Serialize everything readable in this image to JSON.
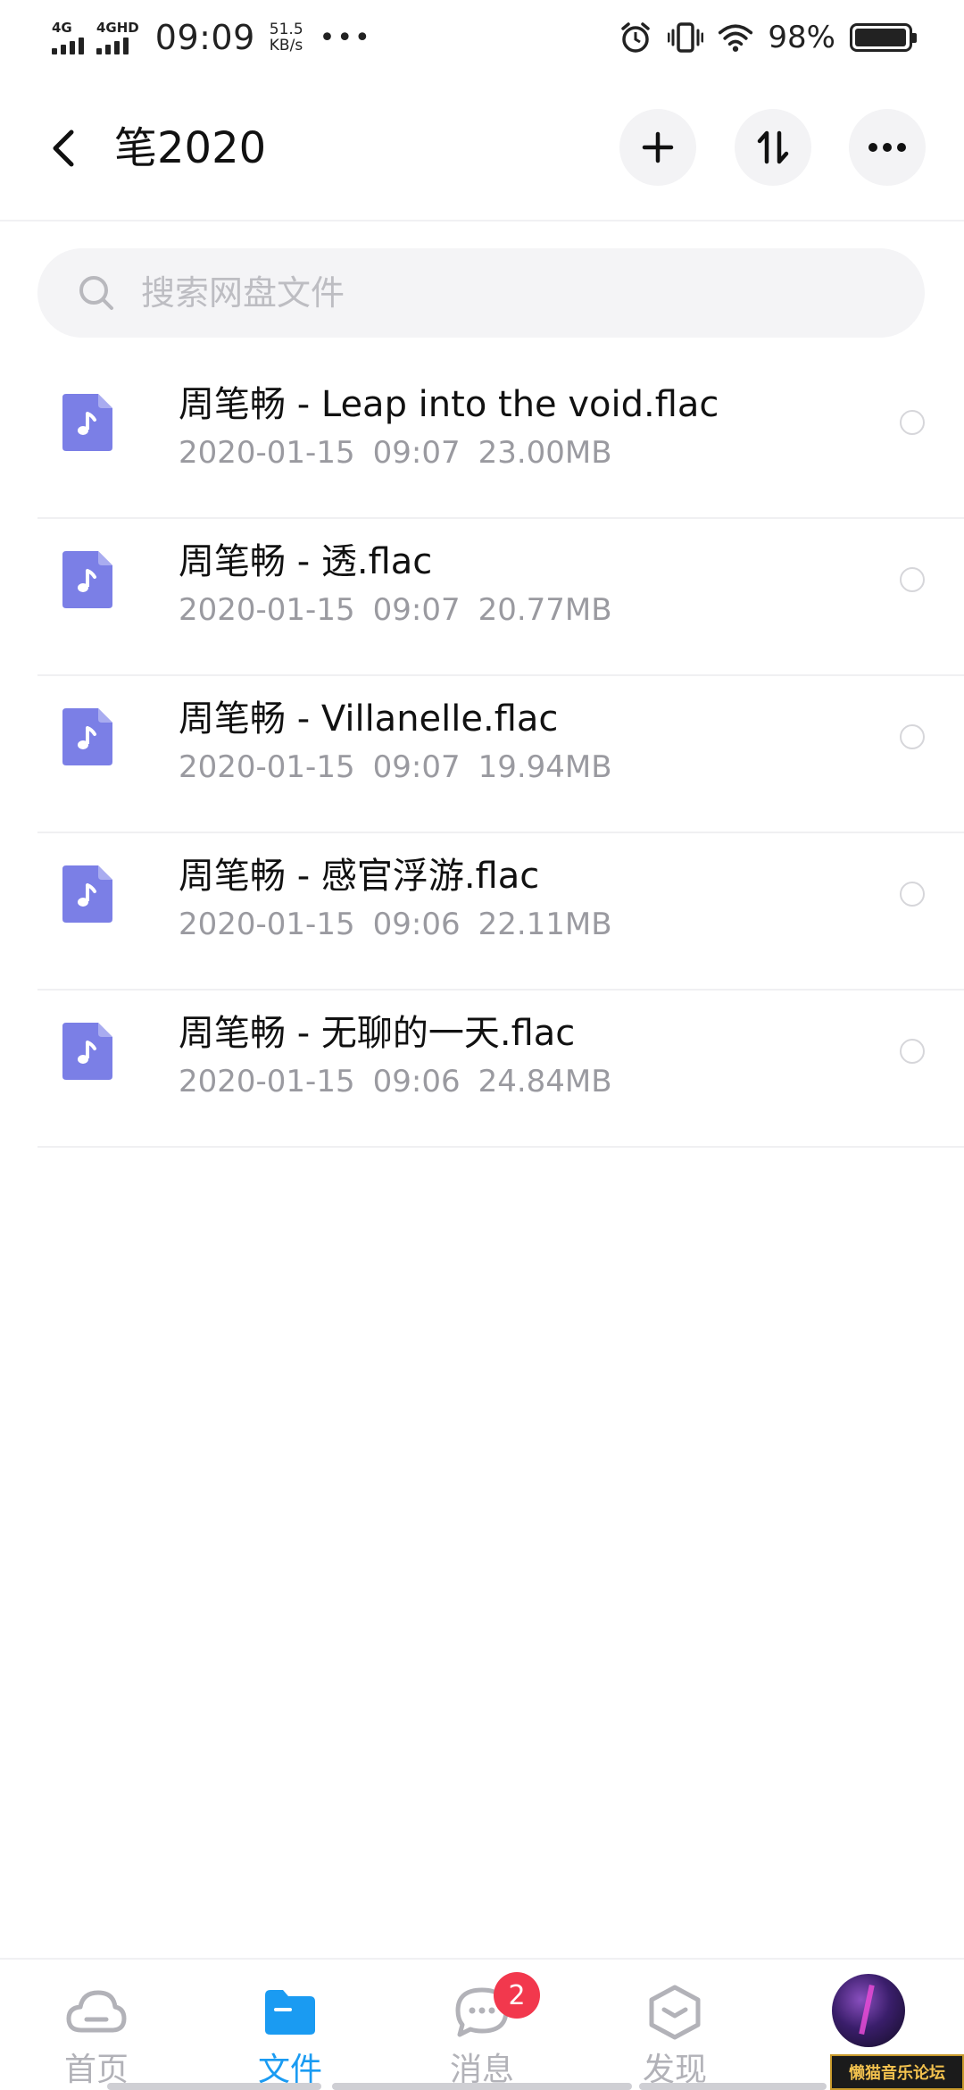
{
  "status_bar": {
    "signal1_label": "4G",
    "signal2_label": "4GHD",
    "time": "09:09",
    "speed_value": "51.5",
    "speed_unit": "KB/s",
    "more": "•••",
    "battery_text": "98%",
    "battery_level": 0.98
  },
  "header": {
    "title": "笔2020",
    "add_icon": "plus-icon",
    "sort_icon": "sort-arrows-icon",
    "more_icon": "more-dots-icon"
  },
  "search": {
    "placeholder": "搜索网盘文件"
  },
  "files": [
    {
      "name": "周笔畅 - Leap into the void.flac",
      "date": "2020-01-15",
      "time": "09:07",
      "size": "23.00MB"
    },
    {
      "name": "周笔畅 - 透.flac",
      "date": "2020-01-15",
      "time": "09:07",
      "size": "20.77MB"
    },
    {
      "name": "周笔畅 - Villanelle.flac",
      "date": "2020-01-15",
      "time": "09:07",
      "size": "19.94MB"
    },
    {
      "name": "周笔畅 - 感官浮游.flac",
      "date": "2020-01-15",
      "time": "09:06",
      "size": "22.11MB"
    },
    {
      "name": "周笔畅 - 无聊的一天.flac",
      "date": "2020-01-15",
      "time": "09:06",
      "size": "24.84MB"
    }
  ],
  "bottom_nav": {
    "home": "首页",
    "files": "文件",
    "messages": "消息",
    "messages_badge": "2",
    "discover": "发现"
  },
  "watermark": "懒猫音乐论坛",
  "colors": {
    "accent": "#1a9bf2",
    "file_icon": "#7b7fe6",
    "badge": "#f2384d"
  }
}
